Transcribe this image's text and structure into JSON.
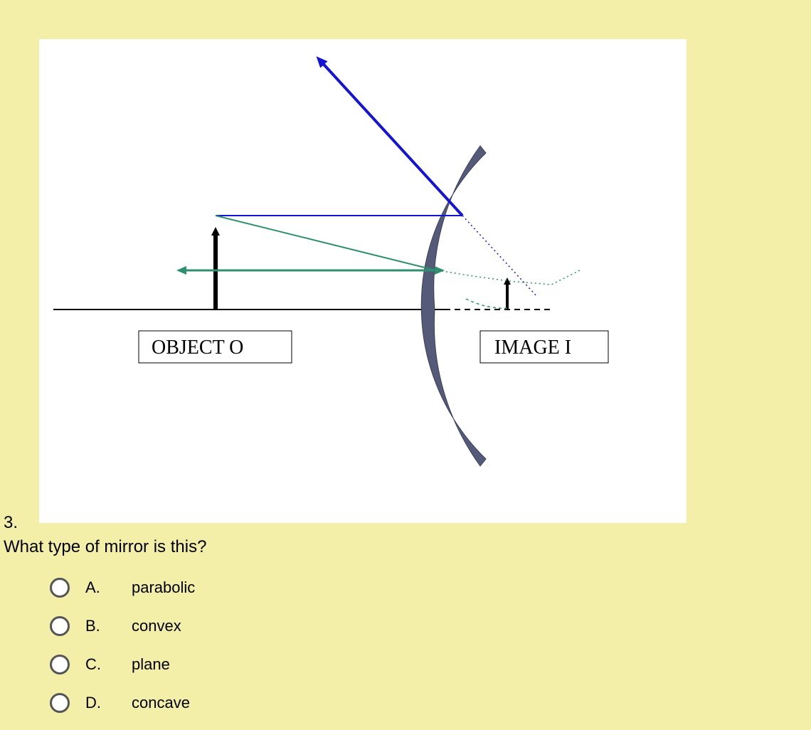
{
  "question": {
    "number": "3.",
    "text": "What type of mirror is this?"
  },
  "diagram": {
    "label_object": "OBJECT O",
    "label_image": "IMAGE I"
  },
  "options": [
    {
      "letter": "A.",
      "text": "parabolic"
    },
    {
      "letter": "B.",
      "text": "convex"
    },
    {
      "letter": "C.",
      "text": "plane"
    },
    {
      "letter": "D.",
      "text": "concave"
    }
  ]
}
